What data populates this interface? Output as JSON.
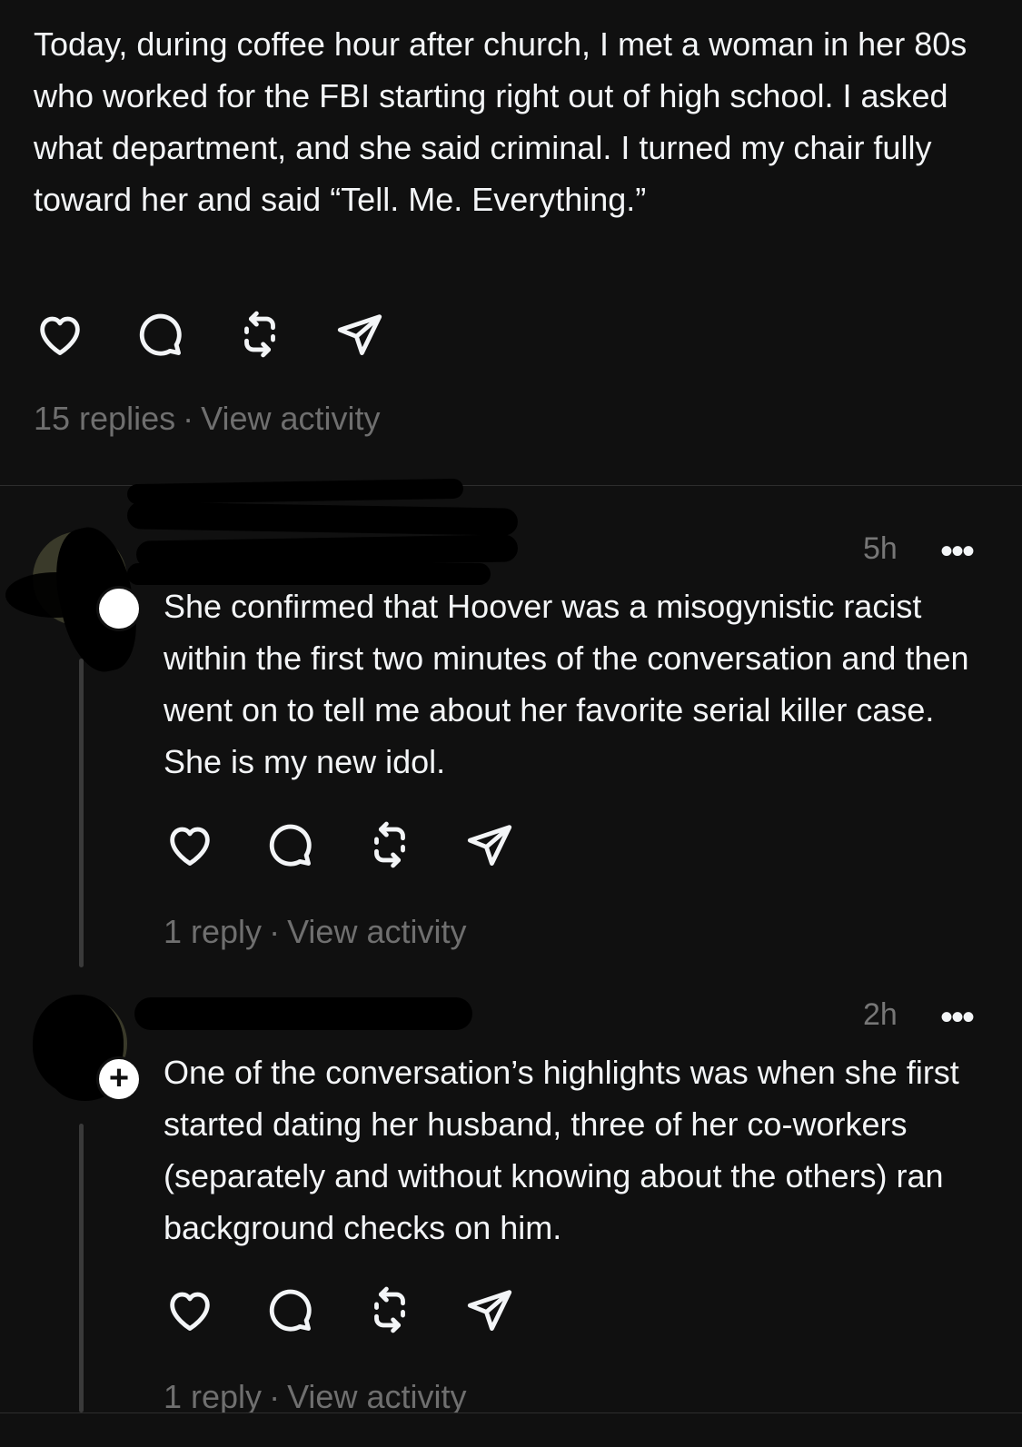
{
  "post": {
    "text": "Today, during coffee hour after church, I met a woman in her 80s who worked for the FBI starting right out of high school. I asked what department, and she said criminal. I turned my chair fully toward her and said “Tell. Me. Everything.”",
    "replies": "15 replies",
    "view_activity": "View activity"
  },
  "replies": [
    {
      "time": "5h",
      "more": "•••",
      "text": "She confirmed that Hoover was a misogynistic racist within the first two minutes of the conversation and then went on to tell me about her favorite serial killer case. She is my new idol.",
      "reply_count": "1 reply",
      "view_activity": "View activity"
    },
    {
      "time": "2h",
      "more": "•••",
      "text": "One of the conversation’s highlights was when she first started dating her husband, three of her co-workers (separately and without knowing about the others) ran background checks on him.",
      "reply_count": "1 reply",
      "view_activity": "View activity"
    }
  ],
  "separator": "·",
  "colors": {
    "background": "#101010",
    "text": "#f3f5f7",
    "muted": "#6f6f6f"
  },
  "icons": [
    "heart-icon",
    "comment-icon",
    "repost-icon",
    "share-icon",
    "more-icon",
    "plus-icon"
  ]
}
